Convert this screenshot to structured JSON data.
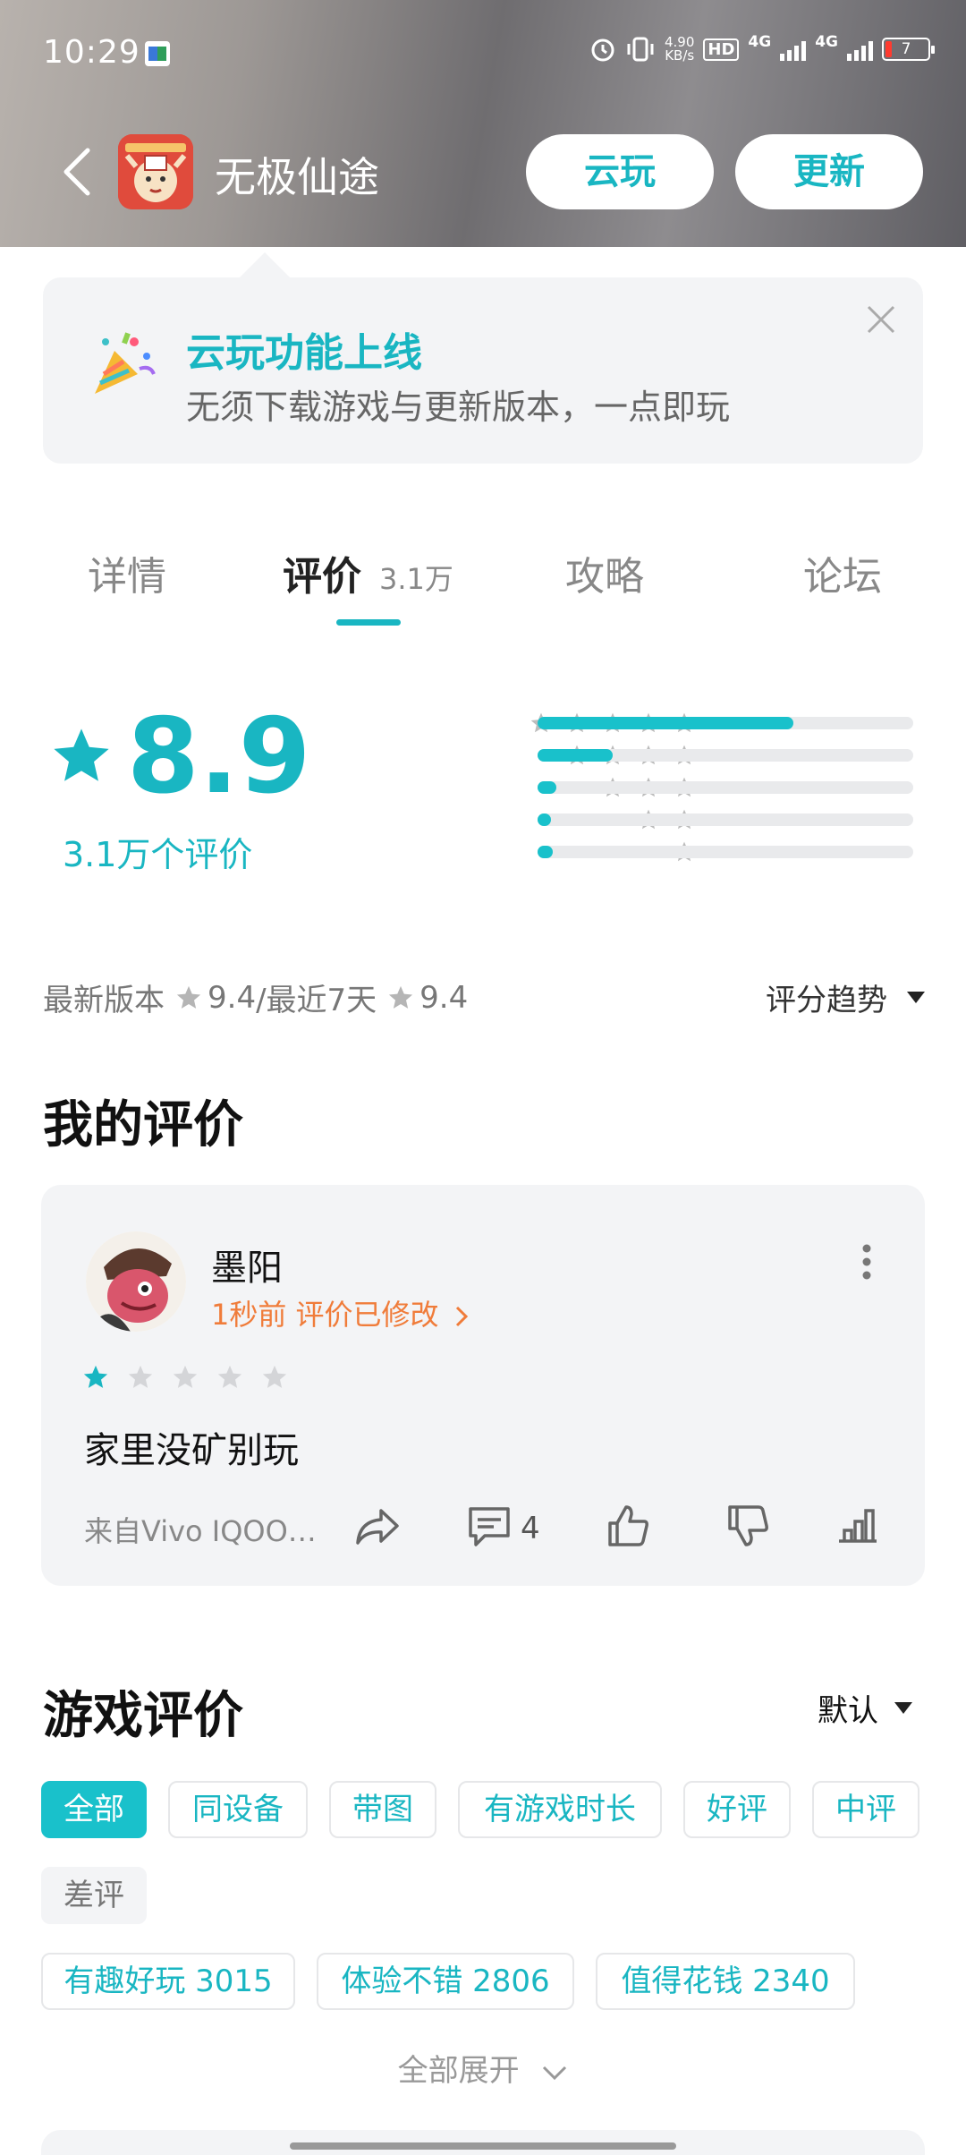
{
  "status_bar": {
    "time": "10:29",
    "net_speed_top": "4.90",
    "net_speed_unit": "KB/s",
    "hd_label": "HD",
    "sim1_label": "4G",
    "sim2_label": "4G",
    "battery_level": "7"
  },
  "header": {
    "app_name": "无极仙途",
    "cloud_play_label": "云玩",
    "update_label": "更新"
  },
  "banner": {
    "title": "云玩功能上线",
    "subtitle": "无须下载游戏与更新版本，一点即玩"
  },
  "tabs": [
    {
      "label": "详情"
    },
    {
      "label": "评价",
      "count": "3.1万"
    },
    {
      "label": "攻略"
    },
    {
      "label": "论坛"
    }
  ],
  "rating": {
    "score": "8.9",
    "count_text": "3.1万个评价",
    "distribution": [
      {
        "stars": 5,
        "fraction": 0.68
      },
      {
        "stars": 4,
        "fraction": 0.2
      },
      {
        "stars": 3,
        "fraction": 0.05
      },
      {
        "stars": 2,
        "fraction": 0.035
      },
      {
        "stars": 1,
        "fraction": 0.04
      }
    ]
  },
  "version_line": {
    "latest_label": "最新版本",
    "latest_score": "9.4",
    "recent_label": "/最近7天",
    "recent_score": "9.4",
    "trend_label": "评分趋势"
  },
  "my_review": {
    "section_title": "我的评价",
    "username": "墨阳",
    "time_text": "1秒前 评价已修改",
    "stars": 1,
    "text": "家里没矿别玩",
    "device": "来自Vivo IQOO…",
    "comment_count": "4"
  },
  "game_reviews": {
    "section_title": "游戏评价",
    "sort_label": "默认",
    "filters": [
      "全部",
      "同设备",
      "带图",
      "有游戏时长",
      "好评",
      "中评",
      "差评"
    ],
    "tags": [
      "有趣好玩 3015",
      "体验不错 2806",
      "值得花钱 2340"
    ],
    "expand_label": "全部展开"
  },
  "colors": {
    "accent": "#19b6c2",
    "orange": "#f07c3a",
    "card_bg": "#f3f4f6"
  }
}
